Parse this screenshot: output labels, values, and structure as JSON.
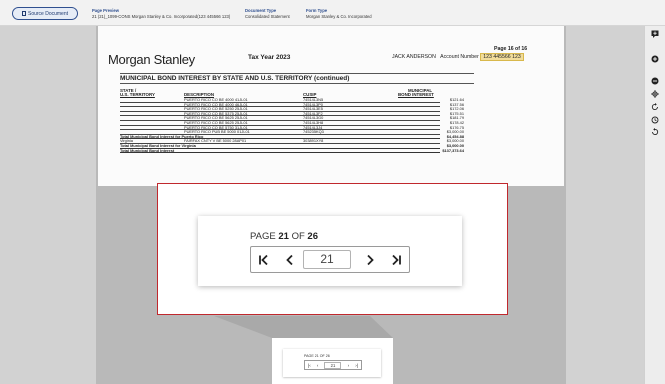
{
  "topbar": {
    "source_button": "Source Document",
    "page_preview_label": "Page Preview",
    "page_preview_value": "21 (21)_1099-CONS Morgan Stanley & Co. Incorporated(123 445566 123)",
    "document_type_label": "Document Type",
    "document_type_value": "Consolidated Statement",
    "form_type_label": "Form Type",
    "form_type_value": "Morgan Stanley & Co. Incorporated"
  },
  "statement": {
    "logo": "Morgan Stanley",
    "tax_year": "Tax Year 2023",
    "account_holder": "JACK ANDERSON",
    "account_label": "Account Number",
    "account_number": "123 445566 123",
    "page_indicator": "Page 16 of 16",
    "section_title": "MUNICIPAL BOND INTEREST BY STATE AND U.S. TERRITORY (continued)",
    "headers": {
      "state": "STATE /",
      "territory": "U.S. TERRITORY",
      "description": "DESCRIPTION",
      "cusip": "CUSIP",
      "municipal": "MUNICIPAL",
      "bond_interest": "BOND INTEREST"
    },
    "rows": [
      {
        "state": "",
        "description": "PUERTO RICO CO BE 4000 41JL01",
        "cusip": "74514L3N5",
        "amount": "$121.64",
        "total": false
      },
      {
        "state": "",
        "description": "PUERTO RICO CO BE 4000 46JL01",
        "cusip": "74514L3P0",
        "amount": "$137.56",
        "total": false
      },
      {
        "state": "",
        "description": "PUERTO RICO CO BE 5250 25JL01",
        "cusip": "74514L3E5",
        "amount": "$172.06",
        "total": false
      },
      {
        "state": "",
        "description": "PUERTO RICO CO BE 5375 25JL01",
        "cusip": "74514L3F2",
        "amount": "$175.51",
        "total": false
      },
      {
        "state": "",
        "description": "PUERTO RICO CO BE 5625 25JL01",
        "cusip": "74514L3G0",
        "amount": "$181.79",
        "total": false
      },
      {
        "state": "",
        "description": "PUERTO RICO CO BE 5625 25JL01",
        "cusip": "74514L3H8",
        "amount": "$178.42",
        "total": false
      },
      {
        "state": "",
        "description": "PUERTO RICO CO BE 5750 31JL01",
        "cusip": "74514L3J4",
        "amount": "$176.75",
        "total": false
      },
      {
        "state": "",
        "description": "PUERTO RICO PUB BE 5000 01JL01",
        "cusip": "745235KQ3",
        "amount": "$3,000.00",
        "total": false
      },
      {
        "state": "Total Municipal Bond Interest for Puerto Rico",
        "description": "",
        "cusip": "",
        "amount": "$4,454.88",
        "total": true
      },
      {
        "state": "Virginia",
        "description": "FAIRFAX CNTY V BE 5000 28AP01",
        "cusip": "303891XY8",
        "amount": "$3,000.00",
        "total": false
      },
      {
        "state": "Total Municipal Bond Interest for Virginia",
        "description": "",
        "cusip": "",
        "amount": "$3,000.00",
        "total": true
      },
      {
        "state": "Total Municipal Bond Interest",
        "description": "",
        "cusip": "",
        "amount": "$137,373.64",
        "total": true
      }
    ]
  },
  "pagination": {
    "prefix": "PAGE",
    "current": "21",
    "of_word": "OF",
    "total": "26",
    "input_value": "21"
  },
  "thumbnail": {
    "label": "PAGE 21 OF 26",
    "input_value": "21"
  },
  "colors": {
    "modal_border": "#c0282d",
    "accent": "#2f4f8f",
    "highlight": "#f1dc9a"
  }
}
